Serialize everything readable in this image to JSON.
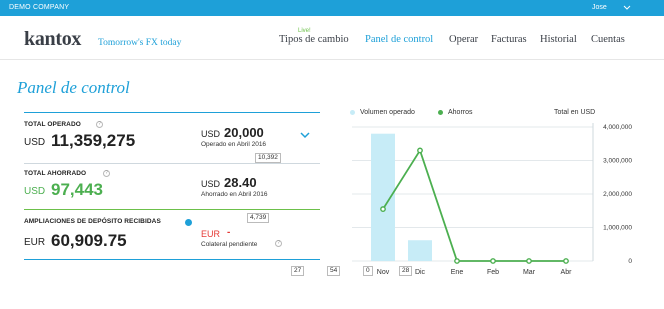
{
  "topbar": {
    "company": "DEMO COMPANY",
    "user": "Jose"
  },
  "header": {
    "logo": "kantox",
    "tagline": "Tomorrow's FX today",
    "live_badge": "Live!",
    "nav": [
      "Tipos de cambio",
      "Panel de control",
      "Operar",
      "Facturas",
      "Historial",
      "Cuentas"
    ],
    "active_nav": "Panel de control"
  },
  "page": {
    "title": "Panel de control"
  },
  "stats": {
    "total_operado": {
      "label": "TOTAL OPERADO",
      "currency": "USD",
      "value": "11,359,275",
      "month_currency": "USD",
      "month_value": "20,000",
      "month_caption": "Operado en Abril 2016",
      "box": "10,392"
    },
    "total_ahorrado": {
      "label": "TOTAL AHORRADO",
      "currency": "USD",
      "value": "97,443",
      "month_currency": "USD",
      "month_value": "28.40",
      "month_caption": "Ahorrado en Abril 2016"
    },
    "ampliaciones": {
      "label": "AMPLIACIONES DE DEPÓSITO RECIBIDAS",
      "currency": "EUR",
      "value": "60,909.75",
      "box": "4,739",
      "pending_currency": "EUR",
      "pending_value": "-",
      "pending_caption": "Colateral pendiente"
    },
    "footer_boxes": [
      "27",
      "54",
      "0",
      "28"
    ]
  },
  "chart_data": {
    "type": "bar",
    "categories": [
      "Nov",
      "Dic",
      "Ene",
      "Feb",
      "Mar",
      "Abr"
    ],
    "series": [
      {
        "name": "Volumen operado",
        "type": "bar",
        "color": "#c7ecf7",
        "values": [
          3800000,
          620000,
          0,
          0,
          0,
          0
        ]
      },
      {
        "name": "Ahorros",
        "type": "line",
        "color": "#4caf50",
        "values": [
          1550000,
          3300000,
          0,
          0,
          0,
          0
        ]
      }
    ],
    "ylabel": "Total en USD",
    "ylim": [
      0,
      4000000
    ],
    "yticks": [
      "0",
      "1,000,000",
      "2,000,000",
      "3,000,000",
      "4,000,000"
    ],
    "legend_position": "top-left"
  }
}
